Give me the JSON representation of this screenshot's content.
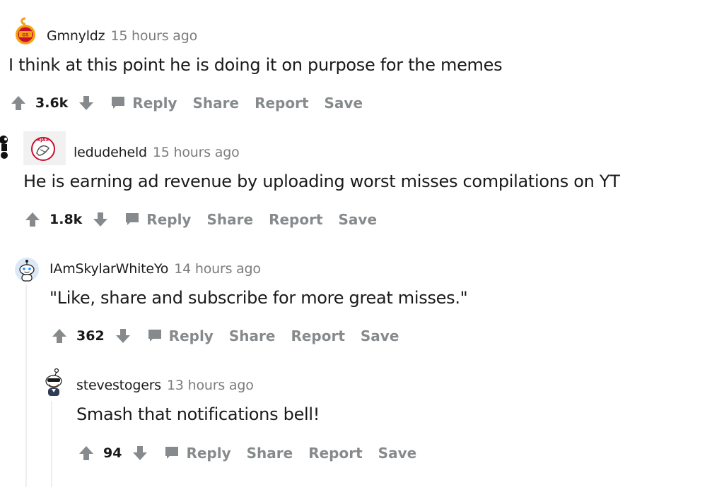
{
  "comments": [
    {
      "username": "Gmnyldz",
      "time": "15 hours ago",
      "text": "I think at this point he is doing it on purpose for the memes",
      "score": "3.6k",
      "avatar": "galatasaray-crest-icon"
    },
    {
      "username": "ledudeheld",
      "time": "15 hours ago",
      "text": "He is earning ad revenue by uploading worst misses compilations on YT",
      "score": "1.8k",
      "avatar": "ajax-crest-icon"
    },
    {
      "username": "IAmSkylarWhiteYo",
      "time": "14 hours ago",
      "text": "\"Like, share and subscribe for more great misses.\"",
      "score": "362",
      "avatar": "snoo-avatar-icon"
    },
    {
      "username": "stevestogers",
      "time": "13 hours ago",
      "text": "Smash that notifications bell!",
      "score": "94",
      "avatar": "snoo-sunglasses-avatar-icon"
    }
  ],
  "actions": {
    "reply": "Reply",
    "share": "Share",
    "report": "Report",
    "save": "Save"
  },
  "colors": {
    "text": "#1a1a1b",
    "meta": "#7c7c7c",
    "action": "#878a8c",
    "thread_line": "#edeff1",
    "galatasaray_orange": "#f2a111",
    "galatasaray_red": "#c8102e"
  }
}
